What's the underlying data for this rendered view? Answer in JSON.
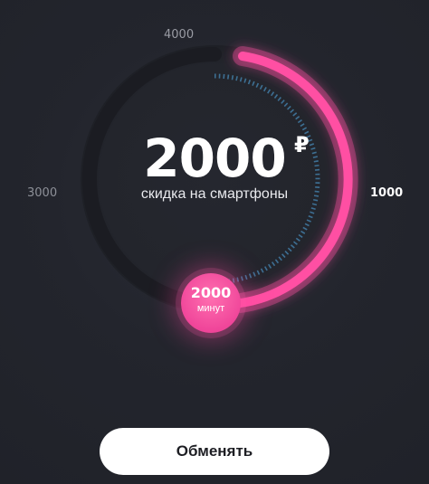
{
  "dial": {
    "current_value": "2000",
    "currency": "₽",
    "subtitle": "скидка на смартфоны",
    "progress_fraction": 0.5,
    "ticks": {
      "top": "4000",
      "left": "3000",
      "right": "1000"
    },
    "knob": {
      "value": "2000",
      "unit": "минут"
    }
  },
  "actions": {
    "exchange_label": "Обменять"
  },
  "colors": {
    "background": "#23252d",
    "accent": "#ff4fa3",
    "track": "#1b1c22",
    "inner_ring_dots": "#3d6f93",
    "button_bg": "#ffffff",
    "button_text": "#1d1e23"
  }
}
